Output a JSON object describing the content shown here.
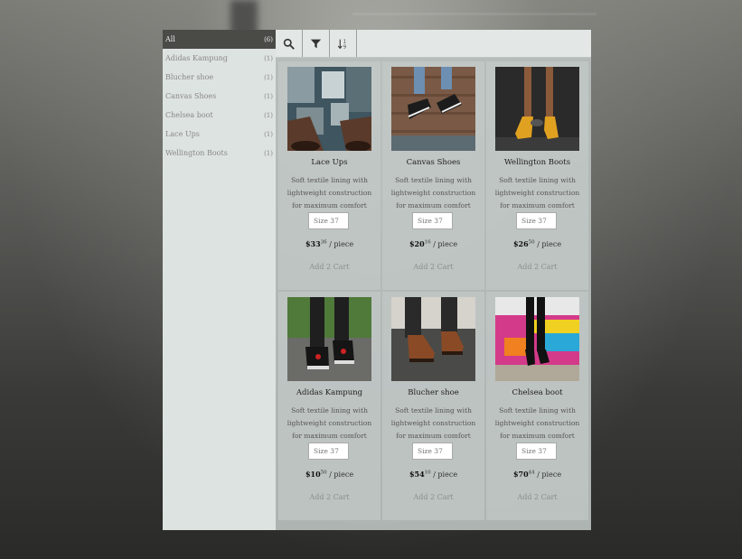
{
  "categories": [
    {
      "label": "All",
      "count": "(6)"
    },
    {
      "label": "Adidas Kampung",
      "count": "(1)"
    },
    {
      "label": "Blucher shoe",
      "count": "(1)"
    },
    {
      "label": "Canvas Shoes",
      "count": "(1)"
    },
    {
      "label": "Chelsea boot",
      "count": "(1)"
    },
    {
      "label": "Lace Ups",
      "count": "(1)"
    },
    {
      "label": "Wellington Boots",
      "count": "(1)"
    }
  ],
  "toolbar": {
    "icons": [
      "search-icon",
      "filter-icon",
      "sort-icon"
    ]
  },
  "products": [
    {
      "name": "Lace Ups",
      "description": "Soft textile lining with lightweight construction for maximum comfort",
      "size_placeholder": "Size 37",
      "price_whole": "$33",
      "price_cents": "36",
      "unit": "/ piece",
      "cart_label": "Add 2 Cart"
    },
    {
      "name": "Canvas Shoes",
      "description": "Soft textile lining with lightweight construction for maximum comfort",
      "size_placeholder": "Size 37",
      "price_whole": "$20",
      "price_cents": "16",
      "unit": "/ piece",
      "cart_label": "Add 2 Cart"
    },
    {
      "name": "Wellington Boots",
      "description": "Soft textile lining with lightweight construction for maximum comfort",
      "size_placeholder": "Size 37",
      "price_whole": "$26",
      "price_cents": "50",
      "unit": "/ piece",
      "cart_label": "Add 2 Cart"
    },
    {
      "name": "Adidas Kampung",
      "description": "Soft textile lining with lightweight construction for maximum comfort",
      "size_placeholder": "Size 37",
      "price_whole": "$10",
      "price_cents": "50",
      "unit": "/ piece",
      "cart_label": "Add 2 Cart"
    },
    {
      "name": "Blucher shoe",
      "description": "Soft textile lining with lightweight construction for maximum comfort",
      "size_placeholder": "Size 37",
      "price_whole": "$54",
      "price_cents": "10",
      "unit": "/ piece",
      "cart_label": "Add 2 Cart"
    },
    {
      "name": "Chelsea boot",
      "description": "Soft textile lining with lightweight construction for maximum comfort",
      "size_placeholder": "Size 37",
      "price_whole": "$70",
      "price_cents": "44",
      "unit": "/ piece",
      "cart_label": "Add 2 Cart"
    }
  ]
}
